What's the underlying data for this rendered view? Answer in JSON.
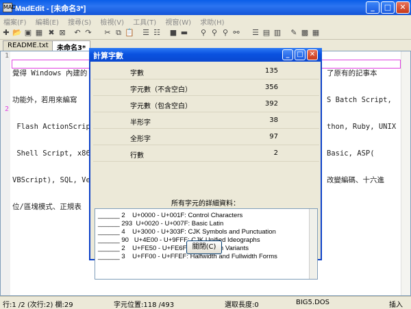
{
  "window": {
    "title": "MadEdit - [未命名3*]",
    "icon_text": "MAD"
  },
  "menu": [
    "檔案(F)",
    "編輯(E)",
    "搜尋(S)",
    "檢視(V)",
    "工具(T)",
    "視窗(W)",
    "求助(H)"
  ],
  "tabs": [
    {
      "label": "README.txt"
    },
    {
      "label": "未命名3*"
    }
  ],
  "editor": {
    "line_numbers": [
      "1",
      "",
      "",
      "",
      "",
      "",
      "2"
    ],
    "lines": [
      "覺得 Windows 內建的",
      "功能外，若用來編寫",
      " Flash ActionScript",
      " Shell Script, x86",
      "VBScript), SQL, Ve",
      "位/區塊模式、正規表"
    ],
    "right_lines": [
      "了原有的記事本",
      "S Batch Script,",
      "thon, Ruby, UNIX",
      "Basic, ASP(",
      "改變編碼、十六進",
      ""
    ]
  },
  "status": {
    "position": "行:1 /2 (次行:2) 欄:29",
    "char_pos": "字元位置:118 /493",
    "selection": "選取長度:0",
    "encoding": "BIG5.DOS",
    "mode": "插入"
  },
  "dialog": {
    "title": "計算字數",
    "stats": [
      {
        "label": "字數",
        "value": "135"
      },
      {
        "label": "字元數（不含空白）",
        "value": "356"
      },
      {
        "label": "字元數（包含空白）",
        "value": "392"
      },
      {
        "label": "半形字",
        "value": "38"
      },
      {
        "label": "全形字",
        "value": "97"
      },
      {
        "label": "行數",
        "value": "2"
      }
    ],
    "detail_label": "所有字元的詳細資料：",
    "details": [
      "______ 2    U+0000 - U+001F: Control Characters",
      "______ 293  U+0020 - U+007F: Basic Latin",
      "______ 4    U+3000 - U+303F: CJK Symbols and Punctuation",
      "______ 90   U+4E00 - U+9FFF: CJK Unified Ideographs",
      "______ 2    U+FE50 - U+FE6F: Small Form Variants",
      "______ 3    U+FF00 - U+FFEF: Halfwidth and Fullwidth Forms"
    ],
    "close_label": "關閉(C)"
  }
}
